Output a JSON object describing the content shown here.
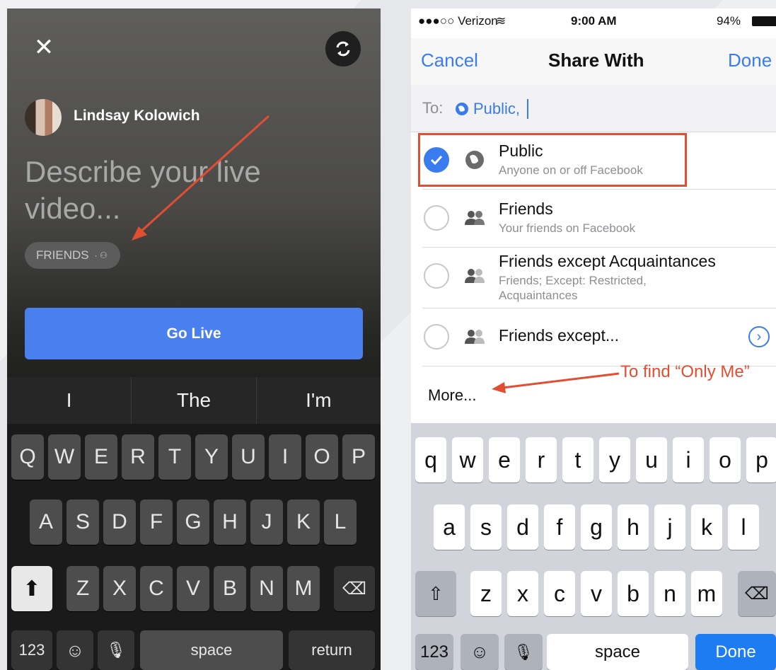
{
  "left": {
    "user_name": "Lindsay Kolowich",
    "prompt": "Describe your live video...",
    "audience": "FRIENDS",
    "go_live": "Go Live",
    "suggestions": [
      "I",
      "The",
      "I'm"
    ],
    "row1": [
      "Q",
      "W",
      "E",
      "R",
      "T",
      "Y",
      "U",
      "I",
      "O",
      "P"
    ],
    "row2": [
      "A",
      "S",
      "D",
      "F",
      "G",
      "H",
      "J",
      "K",
      "L"
    ],
    "row3": [
      "Z",
      "X",
      "C",
      "V",
      "B",
      "N",
      "M"
    ],
    "numbers_key": "123",
    "space_key": "space",
    "return_key": "return"
  },
  "right": {
    "status": {
      "carrier": "●●●○○ Verizon",
      "time": "9:00 AM",
      "battery": "94%"
    },
    "nav": {
      "cancel": "Cancel",
      "title": "Share With",
      "done": "Done"
    },
    "to_label": "To:",
    "to_value": "Public,",
    "options": [
      {
        "title": "Public",
        "subtitle": "Anyone on or off Facebook",
        "selected": true,
        "icon": "globe-icon"
      },
      {
        "title": "Friends",
        "subtitle": "Your friends on Facebook",
        "selected": false,
        "icon": "friends-icon"
      },
      {
        "title": "Friends except Acquaintances",
        "subtitle": "Friends; Except: Restricted, Acquaintances",
        "selected": false,
        "icon": "friends-except-icon"
      },
      {
        "title": "Friends except...",
        "subtitle": "",
        "selected": false,
        "icon": "friends-except-icon"
      }
    ],
    "more": "More...",
    "callout": "To find “Only Me”",
    "row1": [
      "q",
      "w",
      "e",
      "r",
      "t",
      "y",
      "u",
      "i",
      "o",
      "p"
    ],
    "row2": [
      "a",
      "s",
      "d",
      "f",
      "g",
      "h",
      "j",
      "k",
      "l"
    ],
    "row3": [
      "z",
      "x",
      "c",
      "v",
      "b",
      "n",
      "m"
    ],
    "numbers_key": "123",
    "space_key": "space",
    "done_key": "Done"
  },
  "colors": {
    "accent_blue": "#3b7bf0",
    "annotation_red": "#e24e31",
    "go_live_blue": "#4a7ff0"
  }
}
